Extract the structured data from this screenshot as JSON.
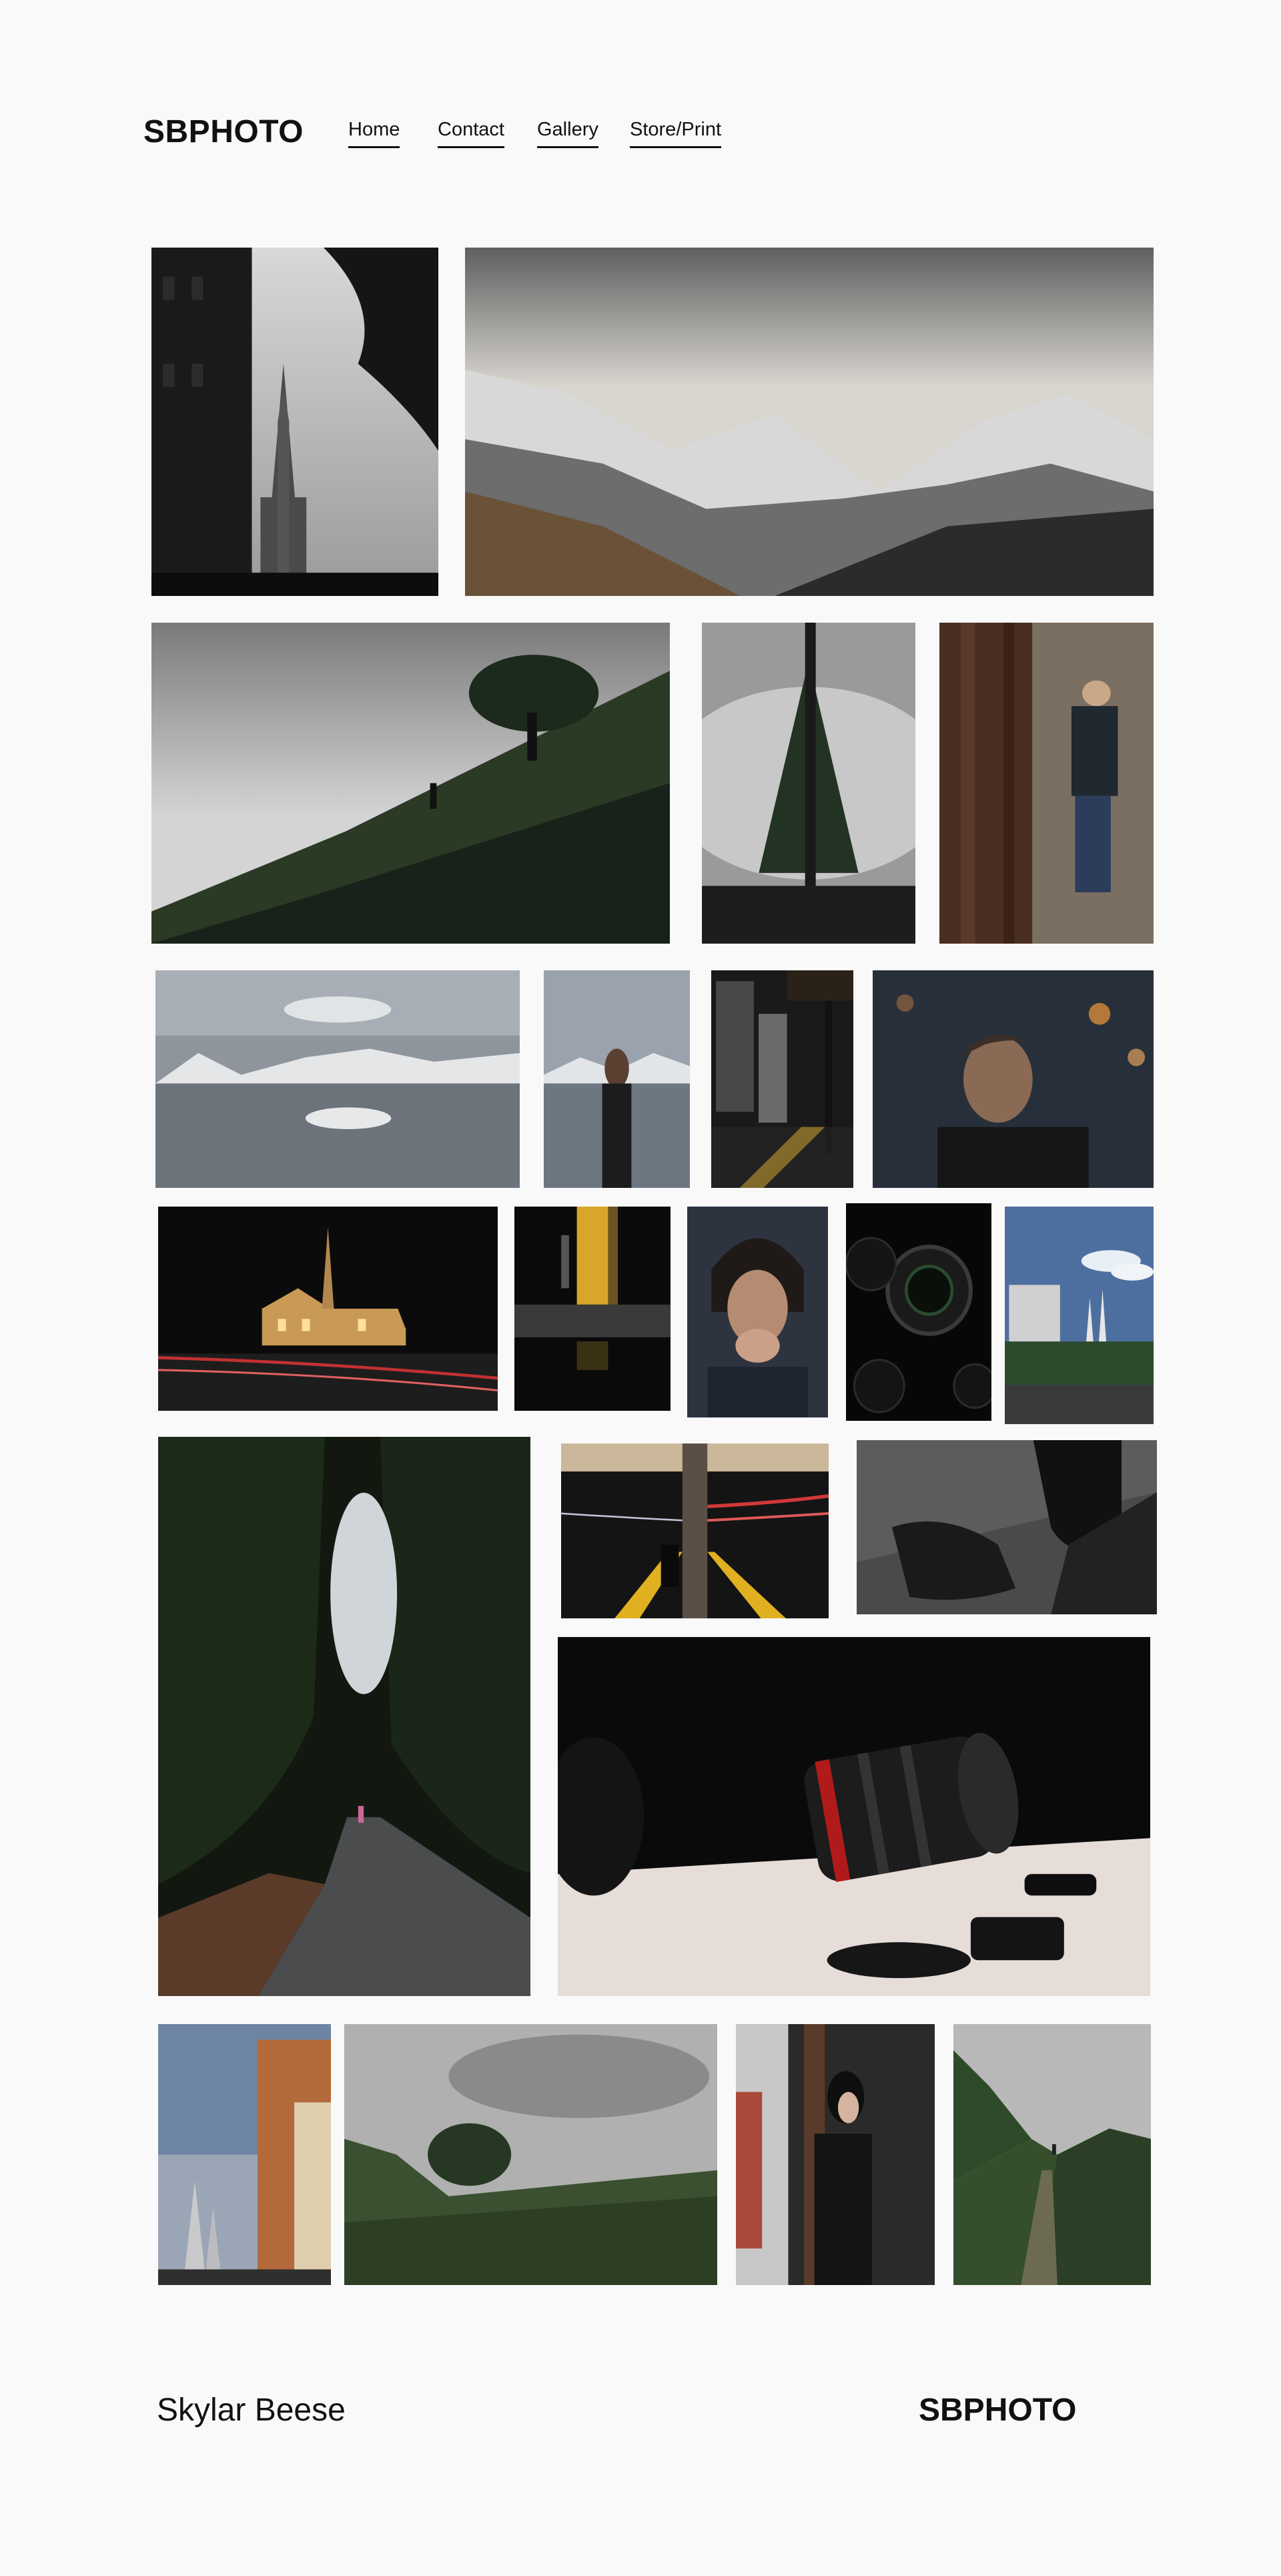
{
  "header": {
    "logo": "SBPHOTO",
    "nav": [
      {
        "label": "Home"
      },
      {
        "label": "Contact"
      },
      {
        "label": "Gallery"
      },
      {
        "label": "Store/Print"
      }
    ]
  },
  "gallery": {
    "photos": [
      {
        "subject": "cathedral spires beside building and tree silhouette"
      },
      {
        "subject": "snow covered mountain ridge under clouds"
      },
      {
        "subject": "tree on grassy hillside with lone figure"
      },
      {
        "subject": "tree reflected symmetric"
      },
      {
        "subject": "woman leaning against rusty wall"
      },
      {
        "subject": "mountain lake reflection"
      },
      {
        "subject": "woman at lake shore"
      },
      {
        "subject": "city street at night"
      },
      {
        "subject": "portrait with bokeh lights"
      },
      {
        "subject": "church at night with light trails"
      },
      {
        "subject": "figure near yellow pillar"
      },
      {
        "subject": "portrait hands to face"
      },
      {
        "subject": "camera lenses on dark background"
      },
      {
        "subject": "temple spires under blue sky"
      },
      {
        "subject": "forest road with walker"
      },
      {
        "subject": "figure on train platform with light trails"
      },
      {
        "subject": "leather boots close up"
      },
      {
        "subject": "camera lens on table with cap"
      },
      {
        "subject": "spires beside apartment building"
      },
      {
        "subject": "green hillside under overcast sky"
      },
      {
        "subject": "woman in leather jacket by brick wall"
      },
      {
        "subject": "figure on trail between hills"
      }
    ]
  },
  "footer": {
    "name": "Skylar Beese",
    "logo": "SBPHOTO"
  }
}
